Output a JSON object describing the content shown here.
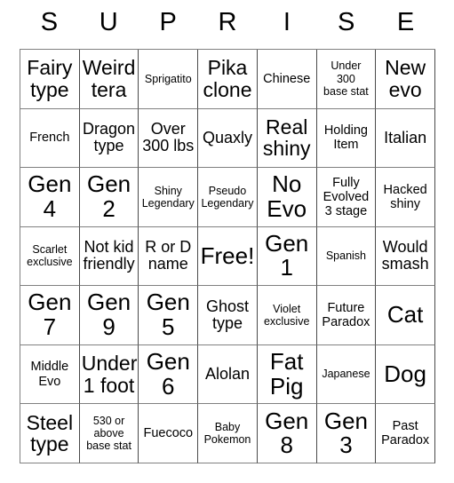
{
  "card": {
    "header_letters": [
      "S",
      "U",
      "P",
      "R",
      "I",
      "S",
      "E"
    ],
    "free_space_label": "Free!",
    "cells": [
      {
        "text": "Fairy\ntype",
        "size": "lg"
      },
      {
        "text": "Weird\ntera",
        "size": "lg"
      },
      {
        "text": "Sprigatito",
        "size": "xs"
      },
      {
        "text": "Pika\nclone",
        "size": "lg"
      },
      {
        "text": "Chinese",
        "size": "sm"
      },
      {
        "text": "Under\n300\nbase stat",
        "size": "xs"
      },
      {
        "text": "New\nevo",
        "size": "lg"
      },
      {
        "text": "French",
        "size": "sm"
      },
      {
        "text": "Dragon\ntype",
        "size": "md"
      },
      {
        "text": "Over\n300 lbs",
        "size": "md"
      },
      {
        "text": "Quaxly",
        "size": "md"
      },
      {
        "text": "Real\nshiny",
        "size": "lg"
      },
      {
        "text": "Holding\nItem",
        "size": "sm"
      },
      {
        "text": "Italian",
        "size": "md"
      },
      {
        "text": "Gen\n4",
        "size": "xl"
      },
      {
        "text": "Gen\n2",
        "size": "xl"
      },
      {
        "text": "Shiny\nLegendary",
        "size": "xs"
      },
      {
        "text": "Pseudo\nLegendary",
        "size": "xs"
      },
      {
        "text": "No\nEvo",
        "size": "xl"
      },
      {
        "text": "Fully\nEvolved\n3 stage",
        "size": "sm"
      },
      {
        "text": "Hacked\nshiny",
        "size": "sm"
      },
      {
        "text": "Scarlet\nexclusive",
        "size": "xs"
      },
      {
        "text": "Not kid\nfriendly",
        "size": "md"
      },
      {
        "text": "R or D\nname",
        "size": "md"
      },
      {
        "text": "Free!",
        "size": "xl"
      },
      {
        "text": "Gen\n1",
        "size": "xl"
      },
      {
        "text": "Spanish",
        "size": "xs"
      },
      {
        "text": "Would\nsmash",
        "size": "md"
      },
      {
        "text": "Gen\n7",
        "size": "xl"
      },
      {
        "text": "Gen\n9",
        "size": "xl"
      },
      {
        "text": "Gen\n5",
        "size": "xl"
      },
      {
        "text": "Ghost\ntype",
        "size": "md"
      },
      {
        "text": "Violet\nexclusive",
        "size": "xs"
      },
      {
        "text": "Future\nParadox",
        "size": "sm"
      },
      {
        "text": "Cat",
        "size": "xl"
      },
      {
        "text": "Middle\nEvo",
        "size": "sm"
      },
      {
        "text": "Under\n1 foot",
        "size": "lg"
      },
      {
        "text": "Gen\n6",
        "size": "xl"
      },
      {
        "text": "Alolan",
        "size": "md"
      },
      {
        "text": "Fat\nPig",
        "size": "xl"
      },
      {
        "text": "Japanese",
        "size": "xs"
      },
      {
        "text": "Dog",
        "size": "xl"
      },
      {
        "text": "Steel\ntype",
        "size": "lg"
      },
      {
        "text": "530 or\nabove\nbase stat",
        "size": "xs"
      },
      {
        "text": "Fuecoco",
        "size": "sm"
      },
      {
        "text": "Baby\nPokemon",
        "size": "xs"
      },
      {
        "text": "Gen\n8",
        "size": "xl"
      },
      {
        "text": "Gen\n3",
        "size": "xl"
      },
      {
        "text": "Past\nParadox",
        "size": "sm"
      }
    ]
  },
  "colors": {
    "background": "#ffffff",
    "text": "#000000",
    "grid_line": "#808080"
  }
}
